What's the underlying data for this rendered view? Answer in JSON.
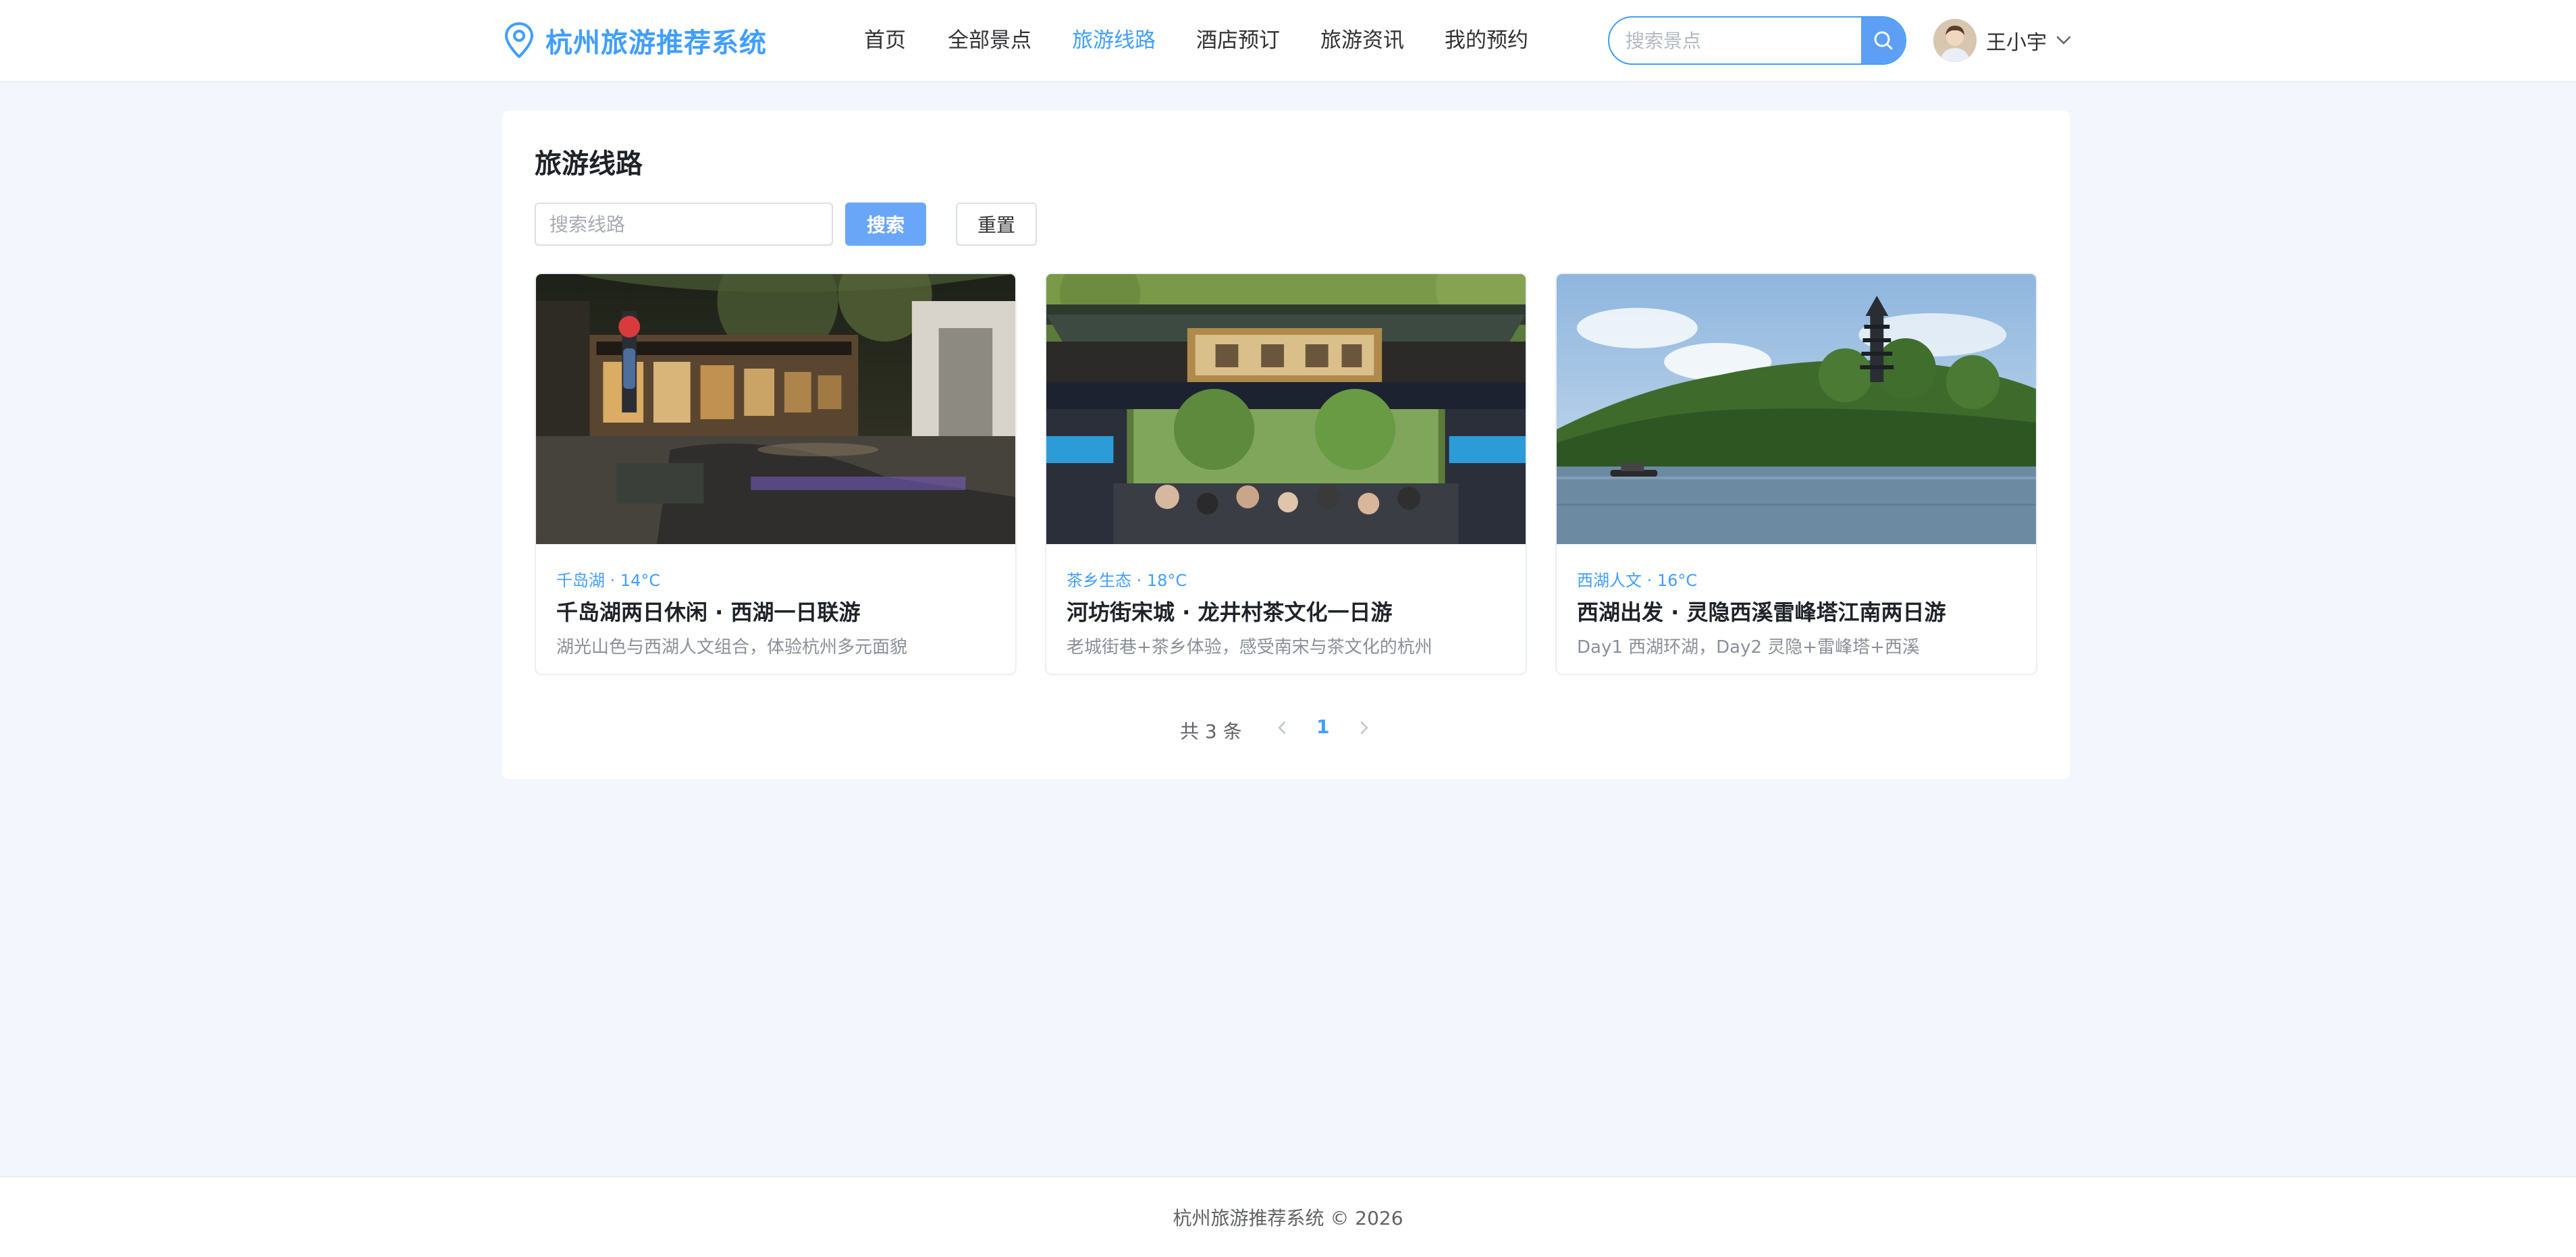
{
  "header": {
    "logo_text": "杭州旅游推荐系统",
    "nav": [
      {
        "label": "首页"
      },
      {
        "label": "全部景点"
      },
      {
        "label": "旅游线路",
        "active": true
      },
      {
        "label": "酒店预订"
      },
      {
        "label": "旅游资讯"
      },
      {
        "label": "我的预约"
      }
    ],
    "search_placeholder": "搜索景点",
    "user_name": "王小宇"
  },
  "main": {
    "title": "旅游线路",
    "filter_placeholder": "搜索线路",
    "search_label": "搜索",
    "reset_label": "重置",
    "cards": [
      {
        "tag": "千岛湖 · 14°C",
        "title": "千岛湖两日休闲 · 西湖一日联游",
        "desc": "湖光山色与西湖人文组合，体验杭州多元面貌",
        "image": "night-street-photo"
      },
      {
        "tag": "茶乡生态 · 18°C",
        "title": "河坊街宋城 · 龙井村茶文化一日游",
        "desc": "老城街巷+茶乡体验，感受南宋与茶文化的杭州",
        "image": "temple-gate-photo"
      },
      {
        "tag": "西湖人文 · 16°C",
        "title": "西湖出发 · 灵隐西溪雷峰塔江南两日游",
        "desc": "Day1 西湖环湖，Day2 灵隐+雷峰塔+西溪",
        "image": "lake-pagoda-photo"
      }
    ],
    "pagination": {
      "total_text": "共 3 条",
      "current_page": "1"
    }
  },
  "footer": {
    "text": "杭州旅游推荐系统 © 2026"
  },
  "colors": {
    "accent": "#409eff",
    "background": "#f3f7fd"
  }
}
